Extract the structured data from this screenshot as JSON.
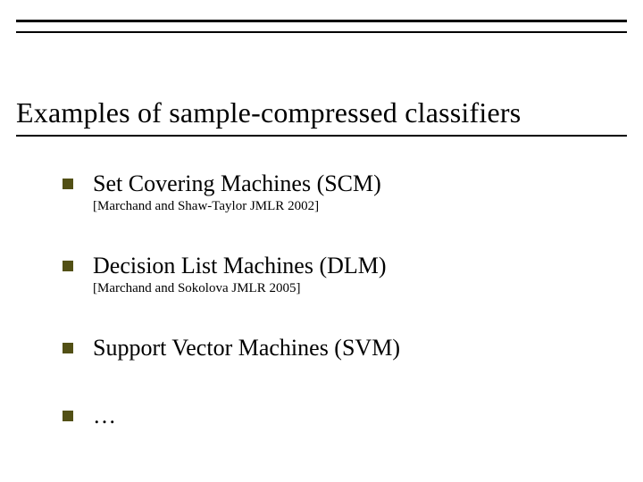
{
  "title": "Examples of sample-compressed classifiers",
  "items": [
    {
      "label": "Set Covering Machines  (SCM)",
      "citation": "[Marchand and Shaw-Taylor  JMLR 2002]"
    },
    {
      "label": "Decision List Machines (DLM)",
      "citation": "[Marchand and Sokolova   JMLR 2005]"
    },
    {
      "label": "Support Vector Machines  (SVM)",
      "citation": ""
    },
    {
      "label": "…",
      "citation": ""
    }
  ],
  "colors": {
    "bullet": "#525015"
  }
}
